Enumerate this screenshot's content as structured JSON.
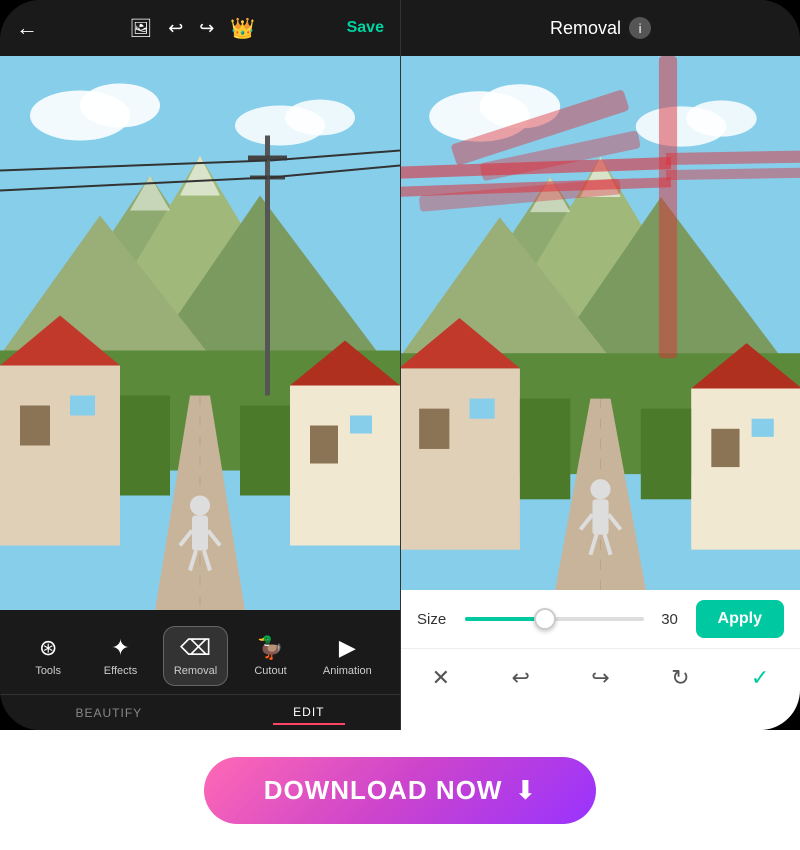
{
  "left_phone": {
    "header": {
      "save_label": "Save",
      "back_icon": "←",
      "image_icon": "🖼",
      "undo_icon": "↩",
      "redo_icon": "↪",
      "crown_icon": "👑"
    },
    "toolbar": {
      "items": [
        {
          "id": "tools",
          "label": "Tools",
          "icon": "⊹"
        },
        {
          "id": "effects",
          "label": "Effects",
          "icon": "✦"
        },
        {
          "id": "removal",
          "label": "Removal",
          "icon": "✂",
          "active": true
        },
        {
          "id": "cutout",
          "label": "Cutout",
          "icon": "🦆"
        },
        {
          "id": "animation",
          "label": "Animation",
          "icon": "▶"
        }
      ]
    },
    "tabs": [
      {
        "id": "beautify",
        "label": "BEAUTIFY"
      },
      {
        "id": "edit",
        "label": "EDIT",
        "active": true
      }
    ]
  },
  "right_phone": {
    "header": {
      "title": "Removal",
      "info_icon": "i"
    },
    "controls": {
      "size_label": "Size",
      "size_value": "30",
      "apply_label": "Apply"
    },
    "actions": [
      {
        "id": "close",
        "icon": "✕"
      },
      {
        "id": "undo",
        "icon": "↩"
      },
      {
        "id": "redo",
        "icon": "↪"
      },
      {
        "id": "reset",
        "icon": "↺"
      },
      {
        "id": "confirm",
        "icon": "✓"
      }
    ]
  },
  "download": {
    "button_text": "DOWNLOAD NOW",
    "button_icon": "⬇"
  }
}
